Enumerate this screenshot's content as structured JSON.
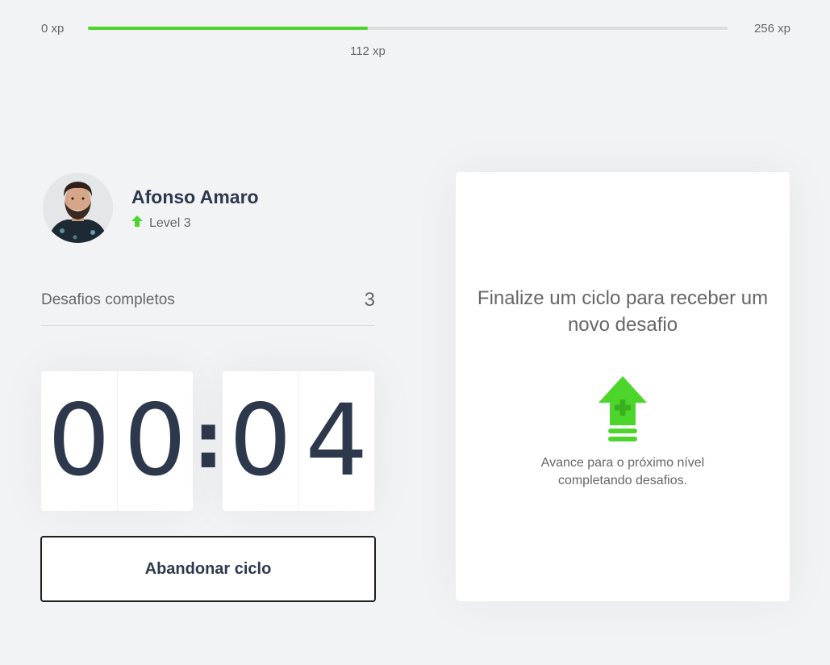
{
  "experience": {
    "min_label": "0 xp",
    "max_label": "256 xp",
    "current_label": "112 xp",
    "current_xp": 112,
    "max_xp": 256,
    "fill_color": "#4cd62b"
  },
  "profile": {
    "name": "Afonso Amaro",
    "level_label": "Level 3",
    "avatar_icon": "avatar-photo",
    "level_icon": "level-up-arrow-icon"
  },
  "challenges": {
    "label": "Desafios completos",
    "count": "3"
  },
  "countdown": {
    "minute_left": "0",
    "minute_right": "0",
    "separator": ":",
    "second_left": "0",
    "second_right": "4"
  },
  "actions": {
    "abandon_label": "Abandonar ciclo"
  },
  "challenge_box": {
    "title": "Finalize um ciclo para receber um novo desafio",
    "icon": "level-up-icon",
    "text": "Avance para o próximo nível completando desafios."
  },
  "colors": {
    "background": "#f2f3f5",
    "accent_green": "#4cd62b",
    "title": "#2e384d",
    "text": "#666666"
  }
}
